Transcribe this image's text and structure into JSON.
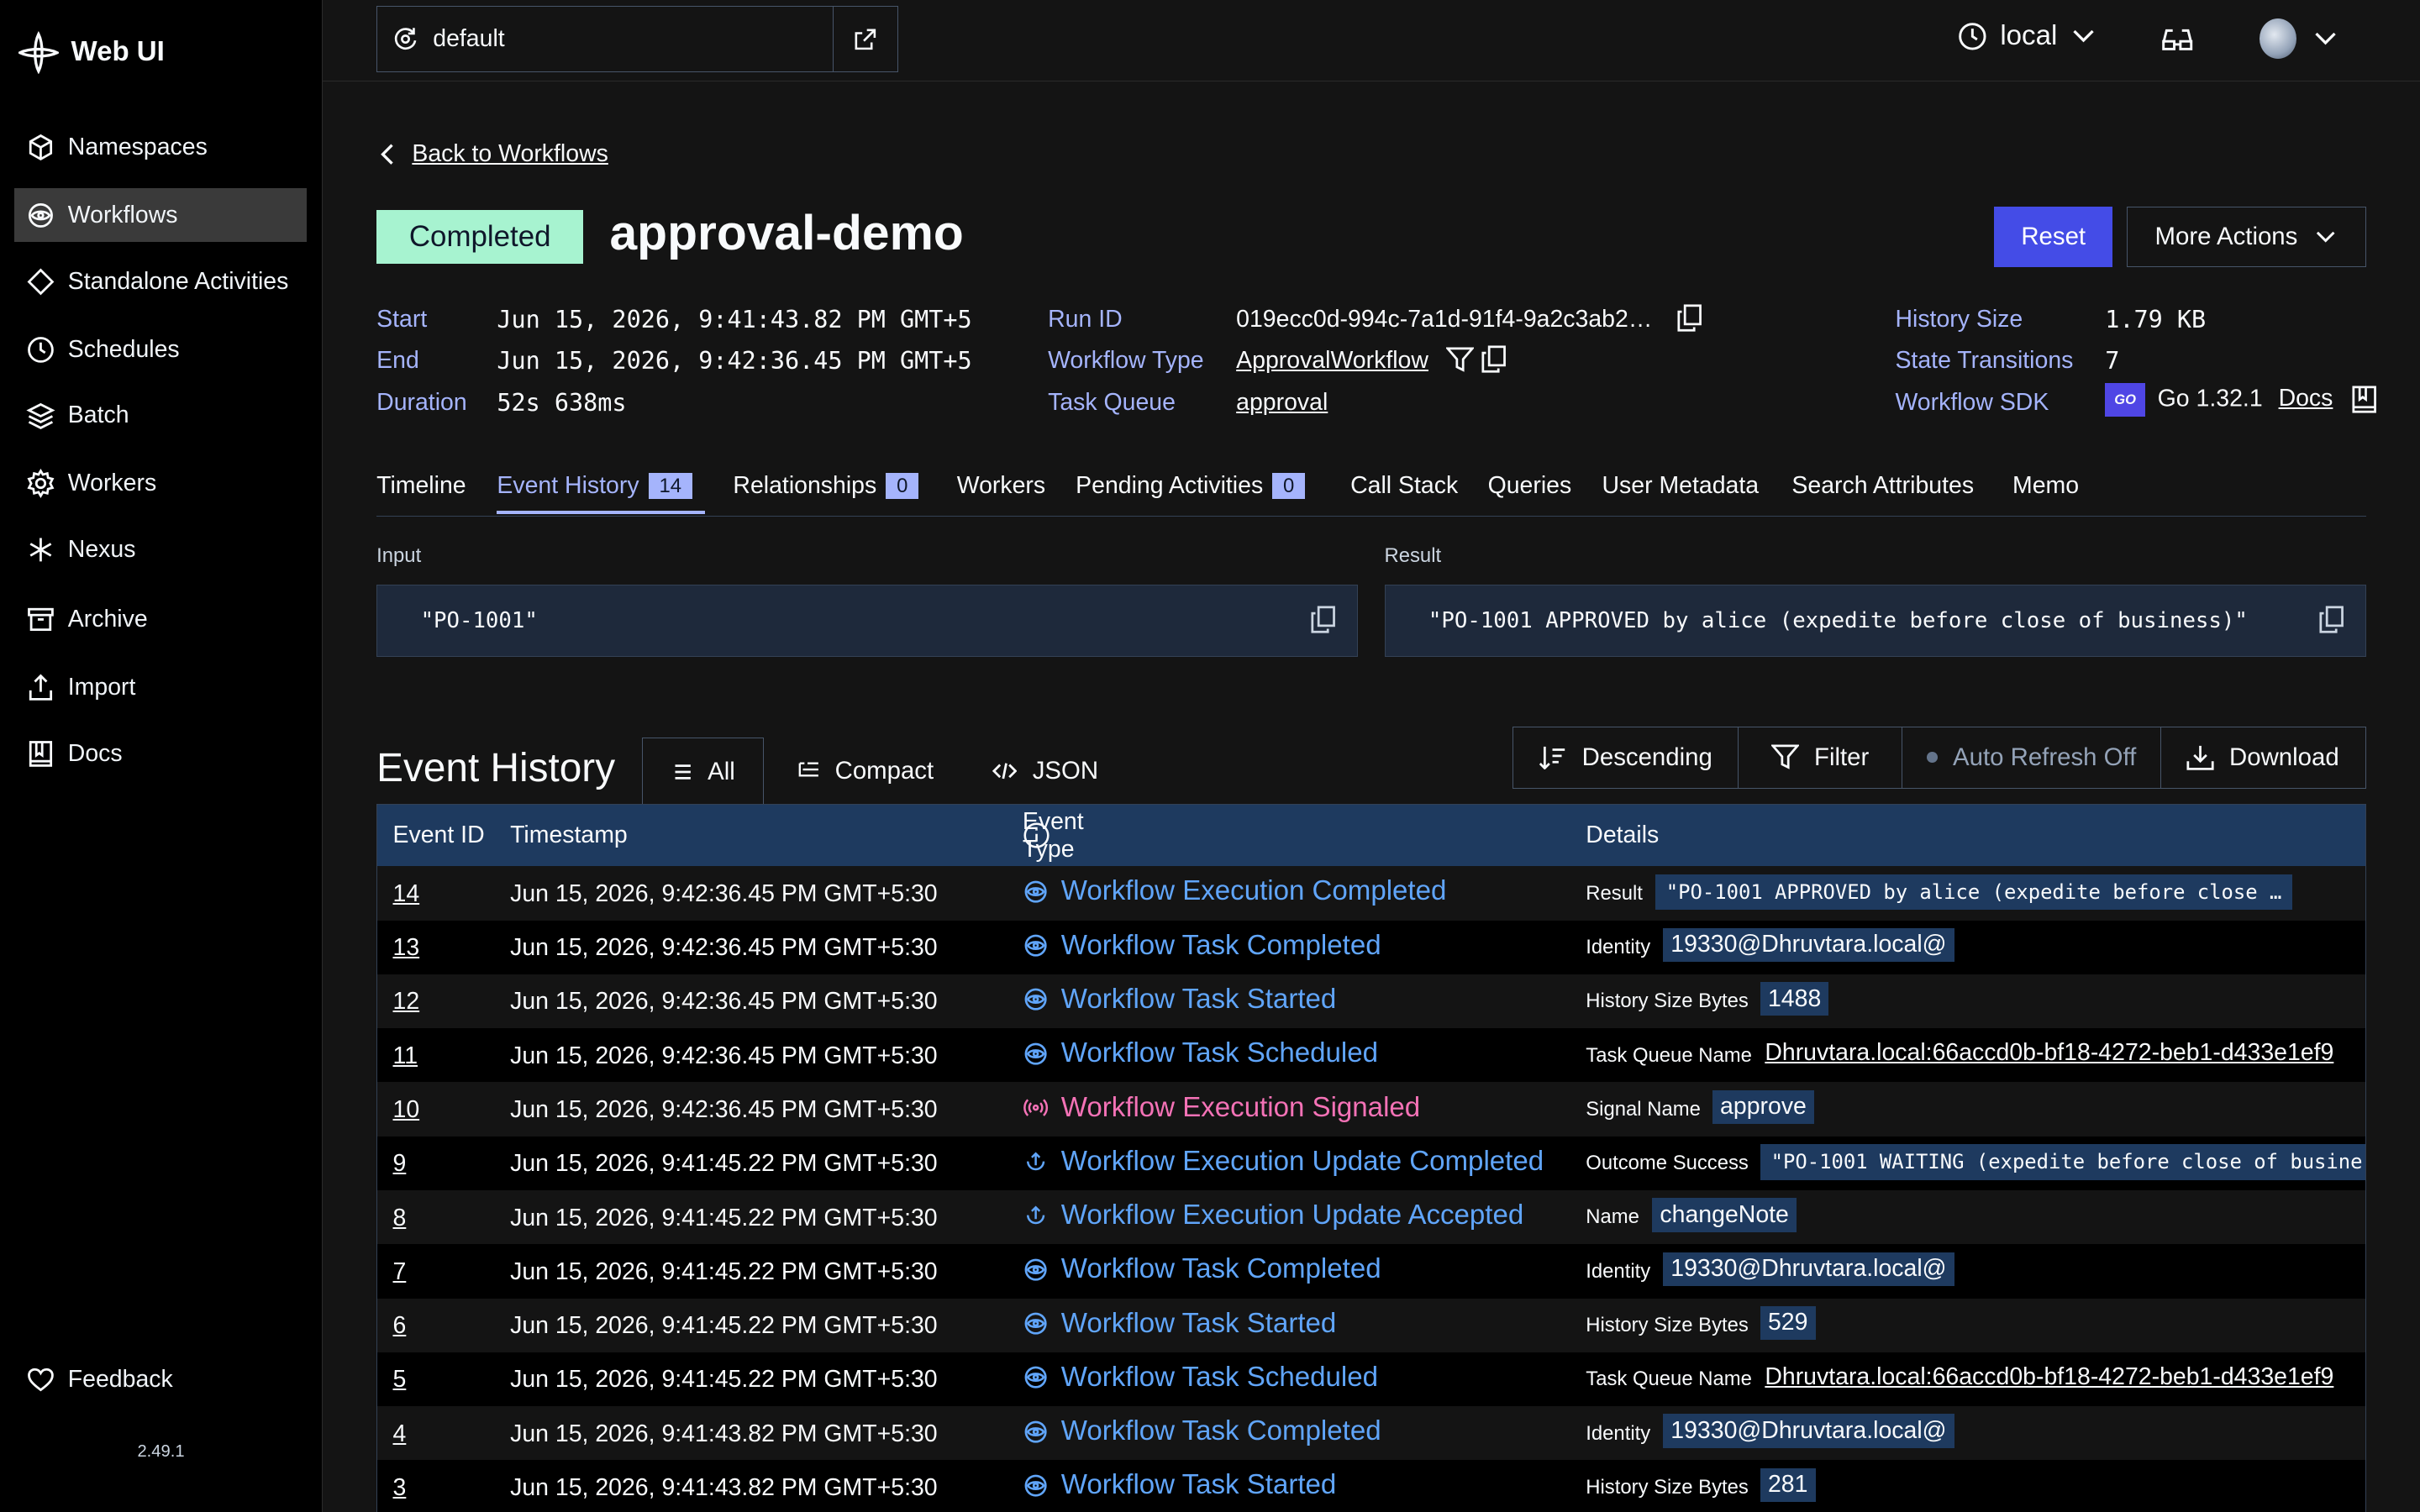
{
  "app": {
    "name": "Web UI",
    "version": "2.49.1"
  },
  "sidebar": {
    "items": [
      {
        "label": "Namespaces",
        "icon": "cube-icon"
      },
      {
        "label": "Workflows",
        "icon": "eye-icon",
        "active": true
      },
      {
        "label": "Standalone Activities",
        "icon": "diamond-icon"
      },
      {
        "label": "Schedules",
        "icon": "clock-icon"
      },
      {
        "label": "Batch",
        "icon": "layers-icon"
      },
      {
        "label": "Workers",
        "icon": "gear-icon"
      },
      {
        "label": "Nexus",
        "icon": "asterisk-icon"
      },
      {
        "label": "Archive",
        "icon": "archive-icon"
      },
      {
        "label": "Import",
        "icon": "upload-icon"
      },
      {
        "label": "Docs",
        "icon": "book-icon"
      }
    ],
    "feedback": "Feedback"
  },
  "header": {
    "namespace": "default",
    "environment": "local"
  },
  "workflow": {
    "back_label": "Back to Workflows",
    "status": "Completed",
    "title": "approval-demo",
    "reset_label": "Reset",
    "more_actions_label": "More Actions",
    "meta": {
      "start_label": "Start",
      "start": "Jun 15, 2026, 9:41:43.82 PM GMT+5",
      "end_label": "End",
      "end": "Jun 15, 2026, 9:42:36.45 PM GMT+5",
      "duration_label": "Duration",
      "duration": "52s 638ms",
      "run_id_label": "Run ID",
      "run_id": "019ecc0d-994c-7a1d-91f4-9a2c3ab2…",
      "workflow_type_label": "Workflow Type",
      "workflow_type": "ApprovalWorkflow",
      "task_queue_label": "Task Queue",
      "task_queue": "approval",
      "history_size_label": "History Size",
      "history_size": "1.79 KB",
      "state_transitions_label": "State Transitions",
      "state_transitions": "7",
      "sdk_label": "Workflow SDK",
      "sdk_badge": "GO",
      "sdk": "Go 1.32.1",
      "sdk_docs": "Docs"
    },
    "tabs": [
      {
        "label": "Timeline"
      },
      {
        "label": "Event History",
        "count": "14",
        "active": true
      },
      {
        "label": "Relationships",
        "count": "0"
      },
      {
        "label": "Workers"
      },
      {
        "label": "Pending Activities",
        "count": "0"
      },
      {
        "label": "Call Stack"
      },
      {
        "label": "Queries"
      },
      {
        "label": "User Metadata"
      },
      {
        "label": "Search Attributes"
      },
      {
        "label": "Memo"
      }
    ],
    "input_label": "Input",
    "input": "\"PO-1001\"",
    "result_label": "Result",
    "result": "\"PO-1001 APPROVED by alice (expedite before close of business)\""
  },
  "event_history": {
    "title": "Event History",
    "views": [
      "All",
      "Compact",
      "JSON"
    ],
    "tools": {
      "sort": "Descending",
      "filter": "Filter",
      "auto_refresh": "Auto Refresh Off",
      "download": "Download"
    },
    "columns": [
      "Event ID",
      "Timestamp",
      "Event Type",
      "Details"
    ],
    "rows": [
      {
        "id": "14",
        "ts": "Jun 15, 2026, 9:42:36.45 PM GMT+5:30",
        "type": "Workflow Execution Completed",
        "kind": "wf",
        "dl": "Result",
        "dv": "\"PO-1001 APPROVED by alice (expedite before close …",
        "style": "mono"
      },
      {
        "id": "13",
        "ts": "Jun 15, 2026, 9:42:36.45 PM GMT+5:30",
        "type": "Workflow Task Completed",
        "kind": "wf",
        "dl": "Identity",
        "dv": "19330@Dhruvtara.local@",
        "style": "chip"
      },
      {
        "id": "12",
        "ts": "Jun 15, 2026, 9:42:36.45 PM GMT+5:30",
        "type": "Workflow Task Started",
        "kind": "wf",
        "dl": "History Size Bytes",
        "dv": "1488",
        "style": "chip"
      },
      {
        "id": "11",
        "ts": "Jun 15, 2026, 9:42:36.45 PM GMT+5:30",
        "type": "Workflow Task Scheduled",
        "kind": "wf",
        "dl": "Task Queue Name",
        "dv": "Dhruvtara.local:66accd0b-bf18-4272-beb1-d433e1ef9",
        "style": "link"
      },
      {
        "id": "10",
        "ts": "Jun 15, 2026, 9:42:36.45 PM GMT+5:30",
        "type": "Workflow Execution Signaled",
        "kind": "signal",
        "dl": "Signal Name",
        "dv": "approve",
        "style": "chip"
      },
      {
        "id": "9",
        "ts": "Jun 15, 2026, 9:41:45.22 PM GMT+5:30",
        "type": "Workflow Execution Update Completed",
        "kind": "update",
        "dl": "Outcome Success",
        "dv": "\"PO-1001 WAITING (expedite before close of busine",
        "style": "mono"
      },
      {
        "id": "8",
        "ts": "Jun 15, 2026, 9:41:45.22 PM GMT+5:30",
        "type": "Workflow Execution Update Accepted",
        "kind": "update",
        "dl": "Name",
        "dv": "changeNote",
        "style": "chip"
      },
      {
        "id": "7",
        "ts": "Jun 15, 2026, 9:41:45.22 PM GMT+5:30",
        "type": "Workflow Task Completed",
        "kind": "wf",
        "dl": "Identity",
        "dv": "19330@Dhruvtara.local@",
        "style": "chip"
      },
      {
        "id": "6",
        "ts": "Jun 15, 2026, 9:41:45.22 PM GMT+5:30",
        "type": "Workflow Task Started",
        "kind": "wf",
        "dl": "History Size Bytes",
        "dv": "529",
        "style": "chip"
      },
      {
        "id": "5",
        "ts": "Jun 15, 2026, 9:41:45.22 PM GMT+5:30",
        "type": "Workflow Task Scheduled",
        "kind": "wf",
        "dl": "Task Queue Name",
        "dv": "Dhruvtara.local:66accd0b-bf18-4272-beb1-d433e1ef9",
        "style": "link"
      },
      {
        "id": "4",
        "ts": "Jun 15, 2026, 9:41:43.82 PM GMT+5:30",
        "type": "Workflow Task Completed",
        "kind": "wf",
        "dl": "Identity",
        "dv": "19330@Dhruvtara.local@",
        "style": "chip"
      },
      {
        "id": "3",
        "ts": "Jun 15, 2026, 9:41:43.82 PM GMT+5:30",
        "type": "Workflow Task Started",
        "kind": "wf",
        "dl": "History Size Bytes",
        "dv": "281",
        "style": "chip"
      }
    ]
  }
}
